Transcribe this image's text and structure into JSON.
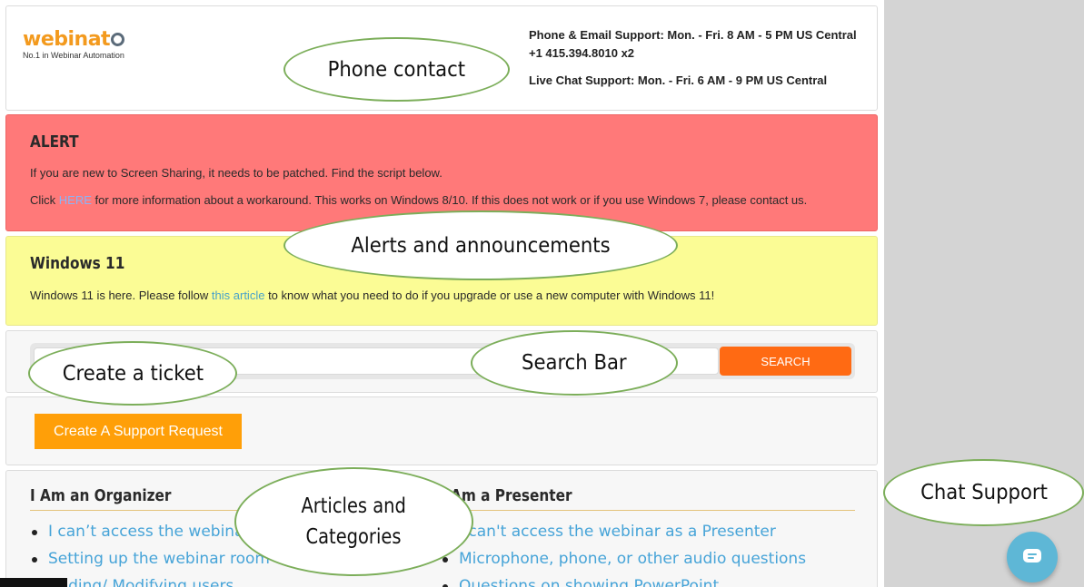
{
  "header": {
    "logo_word": "webinat",
    "logo_tagline": "No.1 in Webinar Automation",
    "phone_support": "Phone & Email Support: Mon. - Fri. 8 AM - 5 PM US Central",
    "phone_number": "+1 415.394.8010 x2",
    "chat_support": "Live Chat Support: Mon. - Fri. 6 AM - 9 PM US Central"
  },
  "alert": {
    "title": "ALERT",
    "line1": "If you are new to Screen Sharing, it needs to be patched. Find the script below.",
    "line2_before": "Click ",
    "line2_link": "HERE",
    "line2_after": " for more information about a workaround. This works on Windows 8/10. If this does not work or if you use Windows 7, please contact us."
  },
  "windows": {
    "title": "Windows 11",
    "line_before": "Windows 11 is here. Please follow ",
    "line_link": "this article",
    "line_after": " to know what you need to do if you upgrade or use a new computer with Windows 11!"
  },
  "search": {
    "placeholder": "",
    "button_label": "SEARCH"
  },
  "ticket": {
    "button_label": "Create A Support Request"
  },
  "categories": {
    "organizer": {
      "title": "I Am an Organizer",
      "items": [
        "I can’t access the webinar",
        "Setting up the webinar room",
        "Adding/ Modifying users"
      ]
    },
    "presenter": {
      "title": "I Am a Presenter",
      "items": [
        "I can't access the webinar as a Presenter",
        "Microphone, phone, or other audio questions",
        "Questions on showing PowerPoint"
      ]
    }
  },
  "callouts": {
    "phone": "Phone contact",
    "alerts": "Alerts and announcements",
    "ticket": "Create a ticket",
    "search": "Search Bar",
    "articles_line1": "Articles and",
    "articles_line2": "Categories",
    "chat": "Chat Support"
  },
  "colors": {
    "alert_bg": "#ff7979",
    "windows_bg": "#fbfc95",
    "search_button": "#ff6a13",
    "ticket_button": "#ff9f08",
    "link": "#47a4d8",
    "callout_border": "#7cae5a",
    "chat_bubble": "#5eb7d6"
  }
}
